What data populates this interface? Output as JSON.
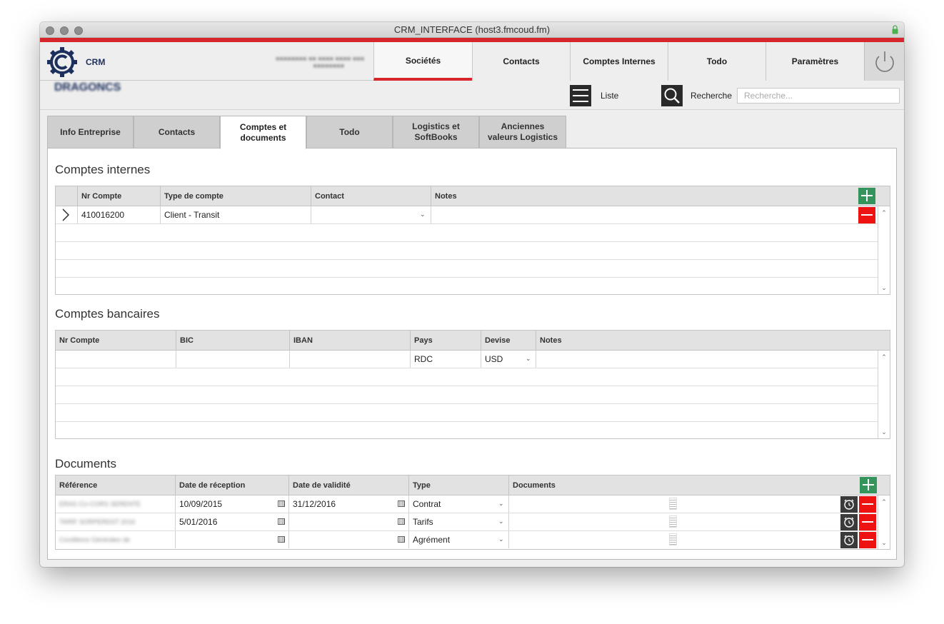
{
  "window": {
    "title": "CRM_INTERFACE (host3.fmcoud.fm)"
  },
  "header": {
    "brand": "CRM",
    "nav": [
      "Sociétés",
      "Contacts",
      "Comptes Internes",
      "Todo",
      "Paramètres"
    ],
    "active_nav": "Sociétés"
  },
  "subbar": {
    "company": "DRAGONCS",
    "list_label": "Liste",
    "search_label": "Recherche",
    "search_placeholder": "Recherche..."
  },
  "tabs": {
    "t1": "Info Entreprise",
    "t2": "Contacts",
    "t3a": "Comptes et",
    "t3b": "documents",
    "t4": "Todo",
    "t5a": "Logistics et",
    "t5b": "SoftBooks",
    "t6a": "Anciennes",
    "t6b": "valeurs Logistics",
    "active": "Comptes et documents"
  },
  "comptes_internes": {
    "title": "Comptes internes",
    "headers": {
      "nr": "Nr Compte",
      "type": "Type de compte",
      "contact": "Contact",
      "notes": "Notes"
    },
    "rows": [
      {
        "nr": "410016200",
        "type": "Client - Transit",
        "contact": "",
        "notes": ""
      }
    ]
  },
  "comptes_bancaires": {
    "title": "Comptes bancaires",
    "headers": {
      "nr": "Nr Compte",
      "bic": "BIC",
      "iban": "IBAN",
      "pays": "Pays",
      "devise": "Devise",
      "notes": "Notes"
    },
    "rows": [
      {
        "nr": "",
        "bic": "",
        "iban": "",
        "pays": "RDC",
        "devise": "USD",
        "notes": ""
      }
    ]
  },
  "documents": {
    "title": "Documents",
    "headers": {
      "ref": "Référence",
      "reception": "Date de réception",
      "validite": "Date de validité",
      "type": "Type",
      "docs": "Documents"
    },
    "rows": [
      {
        "ref": "ERAS CU-CORS SERENTE",
        "reception": "10/09/2015",
        "validite": "31/12/2016",
        "type": "Contrat"
      },
      {
        "ref": "TARIF SORPERDST 2016",
        "reception": "5/01/2016",
        "validite": "",
        "type": "Tarifs"
      },
      {
        "ref": "Conditions Générales de",
        "reception": "",
        "validite": "",
        "type": "Agrément"
      }
    ]
  },
  "colors": {
    "accent_red": "#d6262b",
    "add_green": "#35945c",
    "delete_red": "#ee1313"
  }
}
